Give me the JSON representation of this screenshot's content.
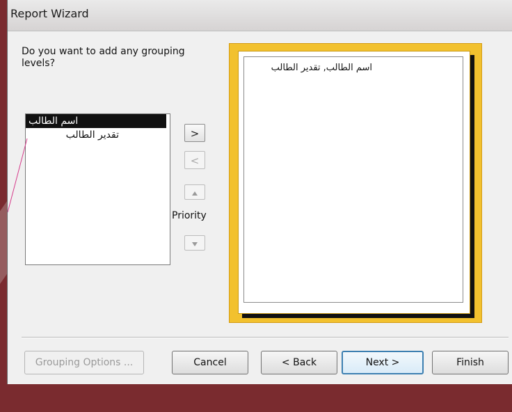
{
  "window": {
    "title": "Report Wizard"
  },
  "prompt": {
    "question": "Do you want to add any grouping levels?"
  },
  "fields_list": {
    "items": [
      {
        "label": "اسم الطالب",
        "selected": true
      },
      {
        "label": "تقدير الطالب",
        "selected": false
      }
    ]
  },
  "move_buttons": {
    "add": ">",
    "remove": "<",
    "priority_label": "Priority"
  },
  "preview": {
    "text": "اسم الطالب, تقدير الطالب"
  },
  "footer": {
    "grouping_options": "Grouping Options ...",
    "cancel": "Cancel",
    "back": "< Back",
    "next": "Next >",
    "finish": "Finish"
  },
  "colors": {
    "preview_frame": "#f2c12e",
    "selection": "#111111",
    "default_button_border": "#3c7fb1",
    "background": "#7a2b2f"
  },
  "icons": {
    "priority_up": "up-arrow-icon",
    "priority_down": "down-arrow-icon"
  }
}
